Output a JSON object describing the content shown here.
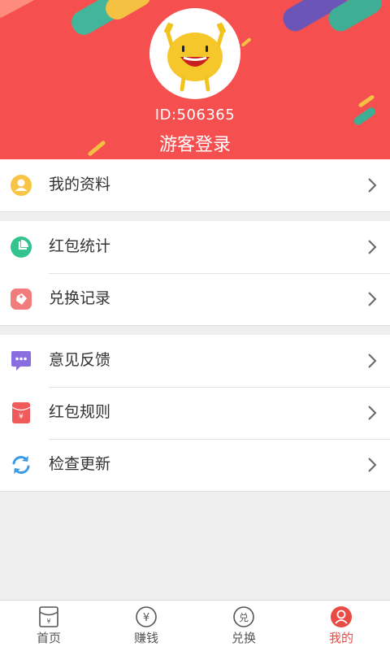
{
  "colors": {
    "header_bg": "#f5504f",
    "accent": "#e94c45"
  },
  "profile": {
    "user_id": "ID:506365",
    "login_label": "游客登录"
  },
  "menu": {
    "group1": [
      {
        "label": "我的资料",
        "icon": "user-icon"
      }
    ],
    "group2": [
      {
        "label": "红包统计",
        "icon": "pie-chart-icon"
      },
      {
        "label": "兑换记录",
        "icon": "tag-icon"
      }
    ],
    "group3": [
      {
        "label": "意见反馈",
        "icon": "chat-bubble-icon"
      },
      {
        "label": "红包规则",
        "icon": "red-envelope-icon"
      },
      {
        "label": "检查更新",
        "icon": "refresh-icon"
      }
    ]
  },
  "tabbar": {
    "tabs": [
      {
        "label": "首页",
        "icon": "envelope-icon",
        "active": false
      },
      {
        "label": "赚钱",
        "icon": "yen-coin-icon",
        "active": false
      },
      {
        "label": "兑换",
        "icon": "exchange-coin-icon",
        "active": false
      },
      {
        "label": "我的",
        "icon": "profile-icon",
        "active": true
      }
    ],
    "icon_glyphs": {
      "yen": "¥",
      "exchange": "兑"
    }
  }
}
